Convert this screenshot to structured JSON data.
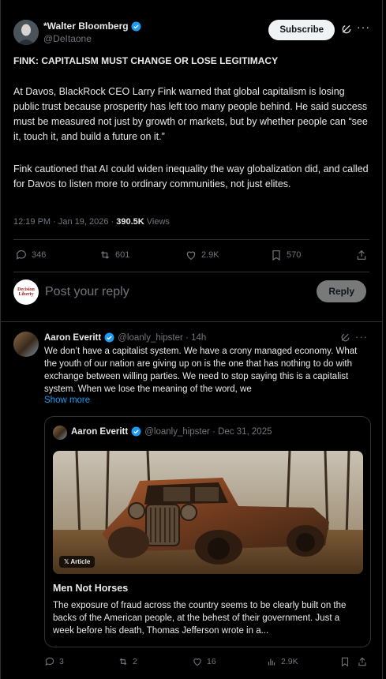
{
  "post": {
    "author_name": "*Walter Bloomberg",
    "handle": "@DeItaone",
    "subscribe_label": "Subscribe",
    "headline": "FINK: CAPITALISM MUST CHANGE OR LOSE LEGITIMACY",
    "paragraph1": "At Davos, BlackRock CEO Larry Fink warned that global capitalism is losing public trust because prosperity has left too many people behind. He said success must be measured not just by growth or markets, but by whether people can “see it, touch it, and build a future on it.”",
    "paragraph2": "Fink cautioned that AI could widen inequality the way globalization did, and called for Davos to listen more to ordinary communities, not just elites.",
    "timestamp": "12:19 PM · Jan 19, 2026 · ",
    "views_count": "390.5K",
    "views_label": " Views",
    "replies": "346",
    "reposts": "601",
    "likes": "2.9K",
    "bookmarks": "570"
  },
  "composer": {
    "avatar_text_line1": "Decision",
    "avatar_text_line2": "Liberty",
    "placeholder": "Post your reply",
    "reply_label": "Reply"
  },
  "comment": {
    "author_name": "Aaron Everitt",
    "handle_time": "@loanly_hipster · 14h",
    "text": "We don’t have a capitalist system. We have a crony managed economy. What the youth of our nation are giving up on is the one that has nothing to do with exchange between willing parties. We need to stop saying this is a capitalist system. When we lose the meaning of the  word, we",
    "show_more": "Show more",
    "quote": {
      "author_name": "Aaron Everitt",
      "handle_date": "@loanly_hipster · Dec 31, 2025",
      "badge": "Article",
      "title": "Men Not Horses",
      "description": "The exposure of fraud across the country seems to be clearly built on the backs of the American people, at the behest of their government. Just a week before his death, Thomas Jefferson wrote in a..."
    },
    "replies": "3",
    "reposts": "2",
    "likes": "16",
    "views": "2.9K"
  },
  "colors": {
    "background": "#000000",
    "text": "#e7e9ea",
    "muted": "#71767b",
    "border": "#2f3336",
    "accent": "#1d9bf0"
  }
}
